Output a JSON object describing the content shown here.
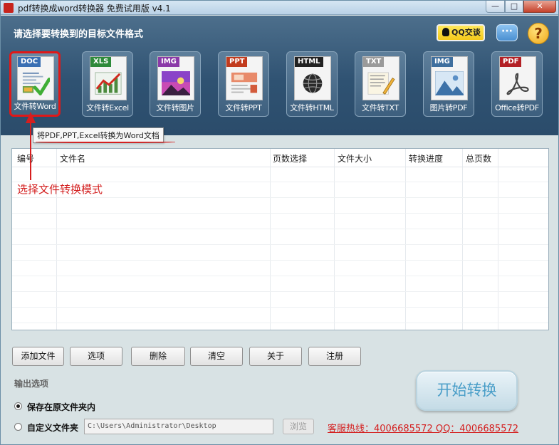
{
  "window": {
    "title": "pdf转换成word转换器 免费试用版 v4.1",
    "min_icon": "—",
    "max_icon": "□",
    "close_icon": "✕"
  },
  "header": {
    "title": "请选择要转换到的目标文件格式",
    "qq_label": "QQ交谈",
    "chat_icon": "···",
    "help_icon": "?"
  },
  "modes": [
    {
      "tag": "DOC",
      "label": "文件转Word",
      "tag_color": "#3a6fb3",
      "selected": true
    },
    {
      "tag": "XLS",
      "label": "文件转Excel",
      "tag_color": "#2e8a3a",
      "selected": false
    },
    {
      "tag": "IMG",
      "label": "文件转图片",
      "tag_color": "#8b3aa8",
      "selected": false
    },
    {
      "tag": "PPT",
      "label": "文件转PPT",
      "tag_color": "#c23b1e",
      "selected": false
    },
    {
      "tag": "HTML",
      "label": "文件转HTML",
      "tag_color": "#222222",
      "selected": false
    },
    {
      "tag": "TXT",
      "label": "文件转TXT",
      "tag_color": "#9a9a9a",
      "selected": false
    },
    {
      "tag": "IMG",
      "label": "图片转PDF",
      "tag_color": "#3f6f9e",
      "selected": false
    },
    {
      "tag": "PDF",
      "label": "Office转PDF",
      "tag_color": "#b32025",
      "selected": false
    }
  ],
  "tooltip": "将PDF,PPT,Excel转换为Word文档",
  "annotation": "选择文件转换模式",
  "table": {
    "columns": [
      "编号",
      "文件名",
      "页数选择",
      "文件大小",
      "转换进度",
      "总页数"
    ]
  },
  "buttons": {
    "add_file": "添加文件",
    "options": "选项",
    "delete": "删除",
    "clear": "清空",
    "about": "关于",
    "register": "注册"
  },
  "output": {
    "section_label": "输出选项",
    "option_keep": "保存在原文件夹内",
    "option_custom": "自定义文件夹",
    "path": "C:\\Users\\Administrator\\Desktop",
    "browse": "浏览"
  },
  "hotline": "客服热线：4006685572 QQ：4006685572",
  "start_button": "开始转换"
}
